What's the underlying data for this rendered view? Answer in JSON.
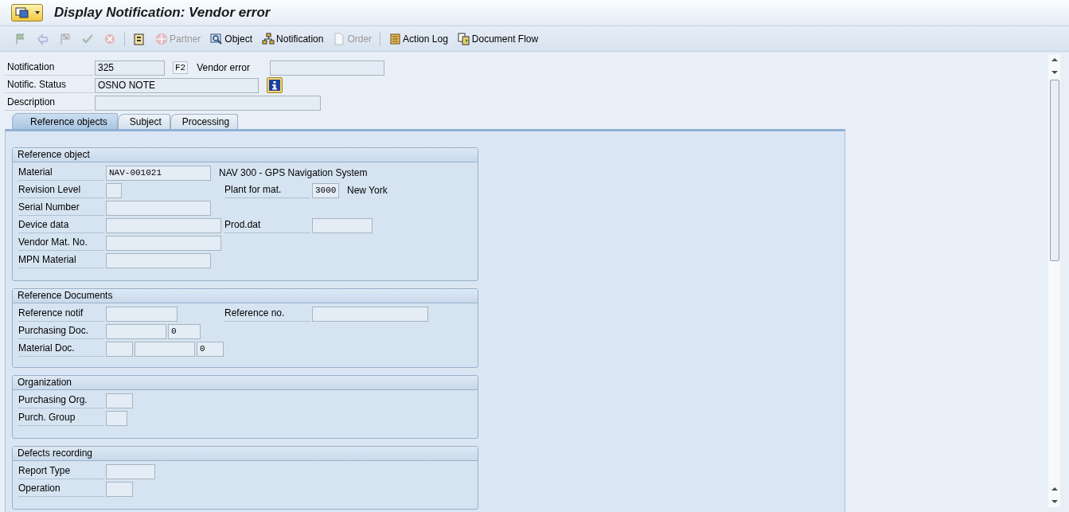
{
  "window": {
    "title": "Display Notification: Vendor error"
  },
  "toolbar": [
    {
      "disabled": true
    },
    {
      "disabled": true
    },
    {
      "disabled": true
    },
    {
      "disabled": true
    },
    {
      "disabled": true
    },
    {
      "disabled": false
    },
    {
      "label": "Partner",
      "disabled": true
    },
    {
      "label": "Object",
      "disabled": false
    },
    {
      "label": "Notification",
      "disabled": false
    },
    {
      "label": "Order",
      "disabled": true
    },
    {
      "label": "Action Log",
      "disabled": false
    },
    {
      "label": "Document Flow",
      "disabled": false
    }
  ],
  "header": {
    "notification": {
      "label": "Notification",
      "value": "325",
      "key": "F2"
    },
    "vendor_error": {
      "label": "Vendor error"
    },
    "status": {
      "label": "Notific. Status",
      "value": "OSNO NOTE"
    },
    "description": {
      "label": "Description"
    }
  },
  "tabs": [
    {
      "label": "Reference objects",
      "selected": true
    },
    {
      "label": "Subject",
      "selected": false
    },
    {
      "label": "Processing",
      "selected": false
    }
  ],
  "groups": [
    {
      "title": "Reference object",
      "rows": [
        {
          "label": "Material",
          "value": "NAV-001021",
          "text": "NAV 300 - GPS Navigation System"
        },
        {
          "label": "Revision Level",
          "right": {
            "label": "Plant for mat.",
            "value": "3000",
            "text": "New York"
          }
        },
        {
          "label": "Serial Number"
        },
        {
          "label": "Device data",
          "right": {
            "label": "Prod.dat"
          }
        },
        {
          "label": "Vendor Mat. No."
        },
        {
          "label": "MPN Material"
        }
      ]
    },
    {
      "title": "Reference Documents",
      "rows": [
        {
          "label": "Reference notif",
          "right": {
            "label": "Reference no."
          }
        },
        {
          "label": "Purchasing Doc.",
          "value": "0"
        },
        {
          "label": "Material Doc.",
          "value": "0"
        }
      ]
    },
    {
      "title": "Organization",
      "rows": [
        {
          "label": "Purchasing Org."
        },
        {
          "label": "Purch. Group"
        }
      ]
    },
    {
      "title": "Defects recording",
      "rows": [
        {
          "label": "Report Type"
        },
        {
          "label": "Operation"
        }
      ]
    }
  ]
}
